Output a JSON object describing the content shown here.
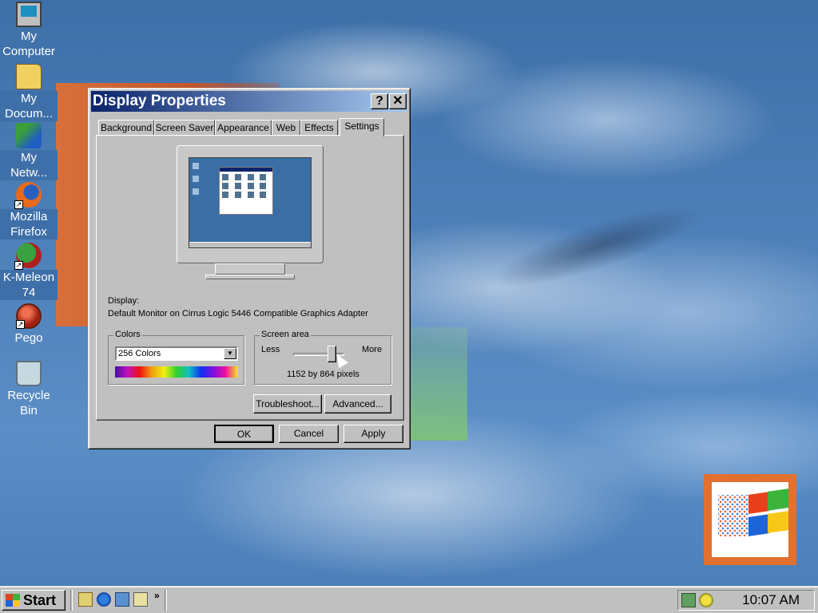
{
  "desktop": {
    "icons": [
      {
        "label_lines": [
          "My",
          "Computer"
        ],
        "icon": "my-computer-icon"
      },
      {
        "label_lines": [
          "My",
          "Docum..."
        ],
        "icon": "my-documents-icon"
      },
      {
        "label_lines": [
          "My",
          "Netw..."
        ],
        "icon": "my-network-icon"
      },
      {
        "label_lines": [
          "Mozilla",
          "Firefox"
        ],
        "icon": "firefox-icon"
      },
      {
        "label_lines": [
          "K-Meleon",
          "74"
        ],
        "icon": "kmeleon-icon"
      },
      {
        "label_lines": [
          "Pego"
        ],
        "icon": "pego-icon"
      },
      {
        "label_lines": [
          "Recycle",
          "Bin"
        ],
        "icon": "recycle-bin-icon"
      }
    ]
  },
  "dialog": {
    "title": "Display Properties",
    "help_button": "?",
    "close_button": "✕",
    "tabs": [
      "Background",
      "Screen Saver",
      "Appearance",
      "Web",
      "Effects",
      "Settings"
    ],
    "active_tab": "Settings",
    "display_label": "Display:",
    "display_value": "Default Monitor on Cirrus Logic 5446 Compatible Graphics Adapter",
    "colors": {
      "legend": "Colors",
      "selected": "256 Colors"
    },
    "screen_area": {
      "legend": "Screen area",
      "less": "Less",
      "more": "More",
      "resolution": "1152 by 864 pixels",
      "slider_fraction": 0.75
    },
    "buttons": {
      "troubleshoot": "Troubleshoot...",
      "advanced": "Advanced...",
      "ok": "OK",
      "cancel": "Cancel",
      "apply": "Apply"
    }
  },
  "taskbar": {
    "start_label": "Start",
    "overflow": "»",
    "clock": "10:07 AM"
  },
  "colors": {
    "titlebar_start": "#0a246a",
    "titlebar_end": "#a6caf0",
    "face": "#c0c0c0",
    "desktop": "#4e80b9"
  }
}
